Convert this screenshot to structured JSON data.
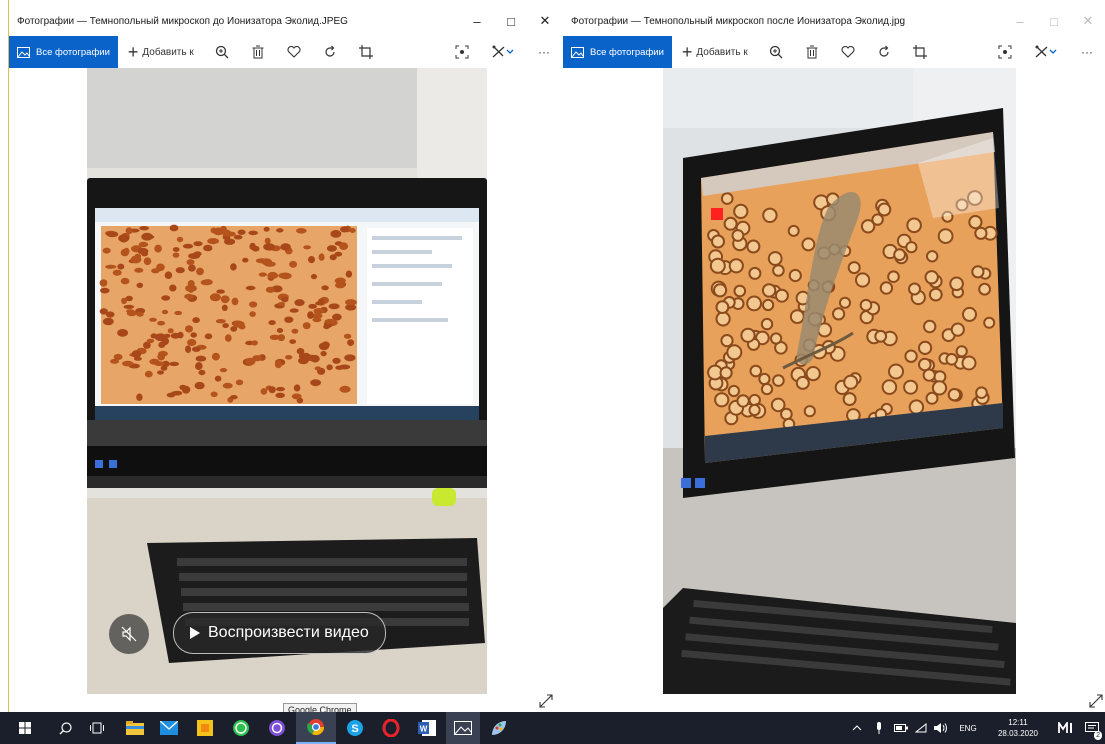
{
  "left_window": {
    "title": "Фотографии — Темнопольный микроскоп до Ионизатора Эколид.JPEG",
    "controls": {
      "minimize": "–",
      "maximize": "□",
      "close": "✕"
    },
    "toolbar": {
      "all_photos": "Все фотографии",
      "add_to": "Добавить к",
      "more": "···"
    },
    "video_overlay": {
      "play_label": "Воспроизвести видео"
    }
  },
  "right_window": {
    "title": "Фотографии — Темнопольный микроскоп после Ионизатора Эколид.jpg",
    "controls": {
      "minimize": "–",
      "maximize": "□",
      "close": "✕"
    },
    "toolbar": {
      "all_photos": "Все фотографии",
      "add_to": "Добавить к",
      "more": "···"
    }
  },
  "taskbar": {
    "tooltip": "Google Chrome",
    "tray": {
      "language": "ENG",
      "time": "12:11",
      "date": "28.03.2020",
      "notification_count": "2"
    }
  },
  "colors": {
    "accent": "#0a63c9",
    "taskbar": "#1b1f2b",
    "micro_bg": "#e8a15a",
    "cell": "#b5531d"
  }
}
